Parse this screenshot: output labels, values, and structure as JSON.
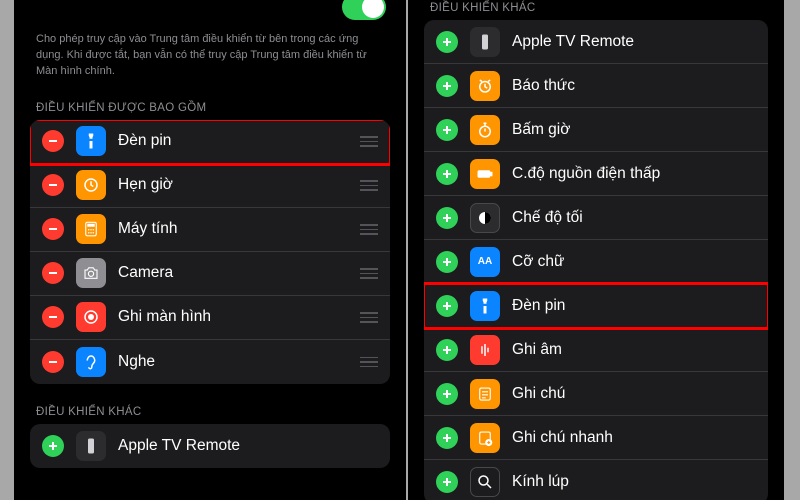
{
  "left": {
    "description": "Cho phép truy cập vào Trung tâm điều khiển từ bên trong các ứng dụng. Khi được tắt, bạn vẫn có thể truy cập Trung tâm điều khiển từ Màn hình chính.",
    "included_header": "ĐIỀU KHIỂN ĐƯỢC BAO GỒM",
    "included": [
      {
        "label": "Đèn pin",
        "icon": "flashlight",
        "highlight": true
      },
      {
        "label": "Hẹn giờ",
        "icon": "timer"
      },
      {
        "label": "Máy tính",
        "icon": "calculator"
      },
      {
        "label": "Camera",
        "icon": "camera"
      },
      {
        "label": "Ghi màn hình",
        "icon": "screen-record"
      },
      {
        "label": "Nghe",
        "icon": "hearing"
      }
    ],
    "more_header": "ĐIỀU KHIỂN KHÁC",
    "more": [
      {
        "label": "Apple TV Remote",
        "icon": "remote"
      }
    ]
  },
  "right": {
    "more_header": "ĐIỀU KHIỂN KHÁC",
    "more": [
      {
        "label": "Apple TV Remote",
        "icon": "remote"
      },
      {
        "label": "Báo thức",
        "icon": "alarm"
      },
      {
        "label": "Bấm giờ",
        "icon": "stopwatch"
      },
      {
        "label": "C.độ nguồn điện thấp",
        "icon": "lowpower"
      },
      {
        "label": "Chế độ tối",
        "icon": "darkmode"
      },
      {
        "label": "Cỡ chữ",
        "icon": "textsize"
      },
      {
        "label": "Đèn pin",
        "icon": "flashlight",
        "highlight": true
      },
      {
        "label": "Ghi âm",
        "icon": "voicemail"
      },
      {
        "label": "Ghi chú",
        "icon": "notes"
      },
      {
        "label": "Ghi chú nhanh",
        "icon": "quicknote"
      },
      {
        "label": "Kính lúp",
        "icon": "magnifier"
      }
    ]
  }
}
